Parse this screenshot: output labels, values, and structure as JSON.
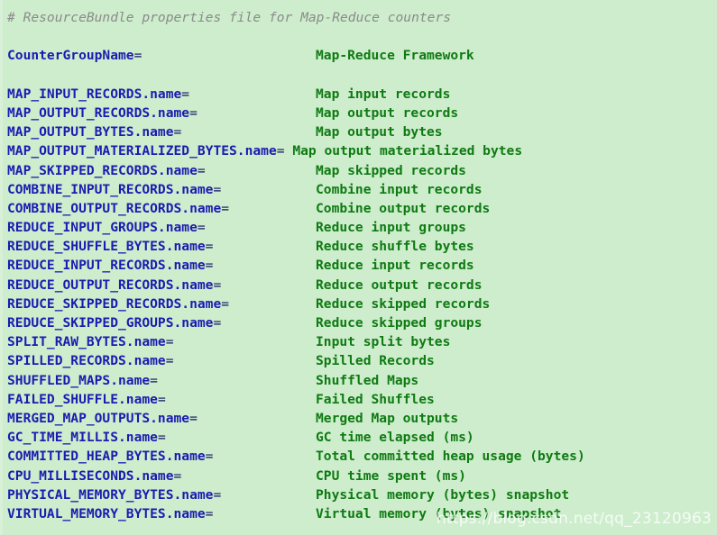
{
  "editor": {
    "background_color": "#cdedcd",
    "comment_color": "#8a8a8a",
    "key_color": "#1b1bb0",
    "value_color": "#0f7a12",
    "comment": "# ResourceBundle properties file for Map-Reduce counters"
  },
  "properties": [
    {
      "key": "CounterGroupName",
      "assign": "=",
      "value": "Map-Reduce Framework",
      "wide": false
    },
    {
      "key": "MAP_INPUT_RECORDS.name",
      "assign": "=",
      "value": "Map input records",
      "wide": false
    },
    {
      "key": "MAP_OUTPUT_RECORDS.name",
      "assign": "=",
      "value": "Map output records",
      "wide": false
    },
    {
      "key": "MAP_OUTPUT_BYTES.name",
      "assign": "=",
      "value": "Map output bytes",
      "wide": false
    },
    {
      "key": "MAP_OUTPUT_MATERIALIZED_BYTES.name",
      "assign": "=",
      "value": " Map output materialized bytes",
      "wide": true
    },
    {
      "key": "MAP_SKIPPED_RECORDS.name",
      "assign": "=",
      "value": "Map skipped records",
      "wide": false
    },
    {
      "key": "COMBINE_INPUT_RECORDS.name",
      "assign": "=",
      "value": "Combine input records",
      "wide": false
    },
    {
      "key": "COMBINE_OUTPUT_RECORDS.name",
      "assign": "=",
      "value": "Combine output records",
      "wide": false
    },
    {
      "key": "REDUCE_INPUT_GROUPS.name",
      "assign": "=",
      "value": "Reduce input groups",
      "wide": false
    },
    {
      "key": "REDUCE_SHUFFLE_BYTES.name",
      "assign": "=",
      "value": "Reduce shuffle bytes",
      "wide": false
    },
    {
      "key": "REDUCE_INPUT_RECORDS.name",
      "assign": "=",
      "value": "Reduce input records",
      "wide": false
    },
    {
      "key": "REDUCE_OUTPUT_RECORDS.name",
      "assign": "=",
      "value": "Reduce output records",
      "wide": false
    },
    {
      "key": "REDUCE_SKIPPED_RECORDS.name",
      "assign": "=",
      "value": "Reduce skipped records",
      "wide": false
    },
    {
      "key": "REDUCE_SKIPPED_GROUPS.name",
      "assign": "=",
      "value": "Reduce skipped groups",
      "wide": false
    },
    {
      "key": "SPLIT_RAW_BYTES.name",
      "assign": "=",
      "value": "Input split bytes",
      "wide": false
    },
    {
      "key": "SPILLED_RECORDS.name",
      "assign": "=",
      "value": "Spilled Records",
      "wide": false
    },
    {
      "key": "SHUFFLED_MAPS.name",
      "assign": "=",
      "value": "Shuffled Maps",
      "wide": false
    },
    {
      "key": "FAILED_SHUFFLE.name",
      "assign": "=",
      "value": "Failed Shuffles",
      "wide": false
    },
    {
      "key": "MERGED_MAP_OUTPUTS.name",
      "assign": "=",
      "value": "Merged Map outputs",
      "wide": false
    },
    {
      "key": "GC_TIME_MILLIS.name",
      "assign": "=",
      "value": "GC time elapsed (ms)",
      "wide": false
    },
    {
      "key": "COMMITTED_HEAP_BYTES.name",
      "assign": "=",
      "value": "Total committed heap usage (bytes)",
      "wide": false
    },
    {
      "key": "CPU_MILLISECONDS.name",
      "assign": "=",
      "value": "CPU time spent (ms)",
      "wide": false
    },
    {
      "key": "PHYSICAL_MEMORY_BYTES.name",
      "assign": "=",
      "value": "Physical memory (bytes) snapshot",
      "wide": false
    },
    {
      "key": "VIRTUAL_MEMORY_BYTES.name",
      "assign": "=",
      "value": "Virtual memory (bytes) snapshot",
      "wide": false
    }
  ],
  "watermark": {
    "text": "https://blog.csdn.net/qq_23120963"
  }
}
